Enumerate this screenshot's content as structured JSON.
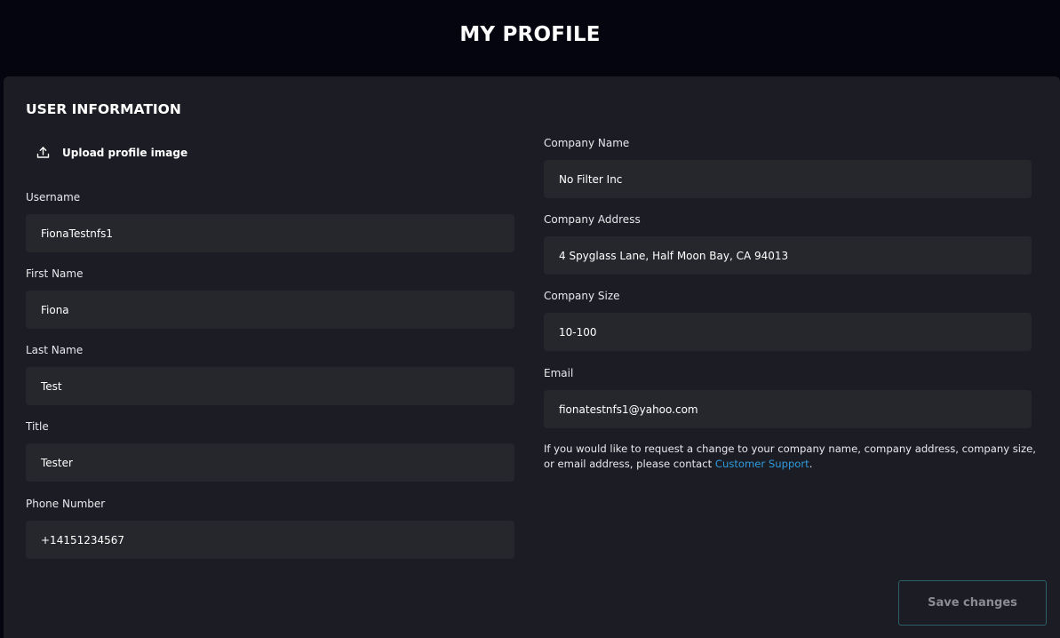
{
  "header": {
    "title": "MY PROFILE"
  },
  "section": {
    "title": "USER INFORMATION"
  },
  "upload": {
    "label": "Upload profile image",
    "icon": "upload-icon"
  },
  "left_fields": {
    "username": {
      "label": "Username",
      "value": "FionaTestnfs1"
    },
    "first_name": {
      "label": "First Name",
      "value": "Fiona"
    },
    "last_name": {
      "label": "Last Name",
      "value": "Test"
    },
    "title": {
      "label": "Title",
      "value": "Tester"
    },
    "phone": {
      "label": "Phone Number",
      "value": "+14151234567"
    }
  },
  "right_fields": {
    "company_name": {
      "label": "Company Name",
      "value": "No Filter Inc"
    },
    "company_address": {
      "label": "Company Address",
      "value": "4 Spyglass Lane, Half Moon Bay, CA 94013"
    },
    "company_size": {
      "label": "Company Size",
      "value": "10-100"
    },
    "email": {
      "label": "Email",
      "value": "fionatestnfs1@yahoo.com"
    }
  },
  "note": {
    "text": "If you would like to request a change to your company name, company address, company size, or email address, please contact ",
    "link": "Customer Support",
    "suffix": "."
  },
  "actions": {
    "save_label": "Save changes"
  },
  "colors": {
    "page_background": "#05050f",
    "card_background": "#1c1d24",
    "input_background": "#26272d",
    "link": "#2f9bdc",
    "save_border": "#2c5f68",
    "save_text": "#8a8b93"
  }
}
